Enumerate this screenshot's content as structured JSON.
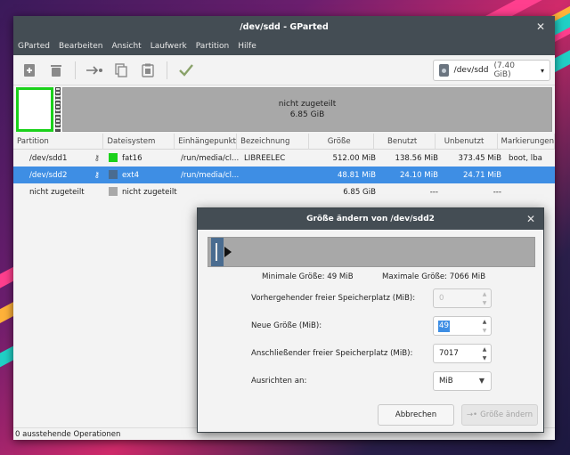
{
  "window": {
    "title": "/dev/sdd - GParted"
  },
  "menu": [
    "GParted",
    "Bearbeiten",
    "Ansicht",
    "Laufwerk",
    "Partition",
    "Hilfe"
  ],
  "toolbar": {
    "buttons": [
      {
        "name": "new-partition-icon",
        "glyph": "▣"
      },
      {
        "name": "delete-partition-icon",
        "glyph": "▬"
      },
      {
        "name": "resize-move-icon",
        "glyph": "→•"
      },
      {
        "name": "copy-icon",
        "glyph": "❐"
      },
      {
        "name": "paste-icon",
        "glyph": "📋"
      },
      {
        "name": "apply-icon",
        "glyph": "✔"
      }
    ],
    "device": {
      "name": "/dev/sdd",
      "size": "(7.40 GiB)"
    }
  },
  "diskmap": {
    "unallocated_label": "nicht zugeteilt",
    "unallocated_size": "6.85 GiB"
  },
  "table": {
    "headers": [
      "Partition",
      "Dateisystem",
      "Einhängepunkt",
      "Bezeichnung",
      "Größe",
      "Benutzt",
      "Unbenutzt",
      "Markierungen"
    ],
    "rows": [
      {
        "partition": "/dev/sdd1",
        "lock": "🔑",
        "fs_color": "#1ad11a",
        "fs": "fat16",
        "mount": "/run/media/cl...",
        "label": "LIBREELEC",
        "size": "512.00 MiB",
        "used": "138.56 MiB",
        "unused": "373.45 MiB",
        "flags": "boot, lba"
      },
      {
        "partition": "/dev/sdd2",
        "lock": "🔑",
        "fs_color": "#4a6c90",
        "fs": "ext4",
        "mount": "/run/media/cl...",
        "label": "",
        "size": "48.81 MiB",
        "used": "24.10 MiB",
        "unused": "24.71 MiB",
        "flags": ""
      },
      {
        "partition": "nicht zugeteilt",
        "lock": "",
        "fs_color": "#a8a8a8",
        "fs": "nicht zugeteilt",
        "mount": "",
        "label": "",
        "size": "6.85 GiB",
        "used": "---",
        "unused": "---",
        "flags": ""
      }
    ]
  },
  "status": "0 ausstehende Operationen",
  "dialog": {
    "title": "Größe ändern von /dev/sdd2",
    "min_size": "Minimale Größe: 49 MiB",
    "max_size": "Maximale Größe: 7066 MiB",
    "fields": {
      "preceding_label": "Vorhergehender freier Speicherplatz (MiB):",
      "preceding_value": "0",
      "new_size_label": "Neue Größe (MiB):",
      "new_size_value": "49",
      "following_label": "Anschließender freier Speicherplatz (MiB):",
      "following_value": "7017",
      "align_label": "Ausrichten an:",
      "align_value": "MiB"
    },
    "cancel_label": "Abbrechen",
    "resize_label": "Größe ändern"
  }
}
